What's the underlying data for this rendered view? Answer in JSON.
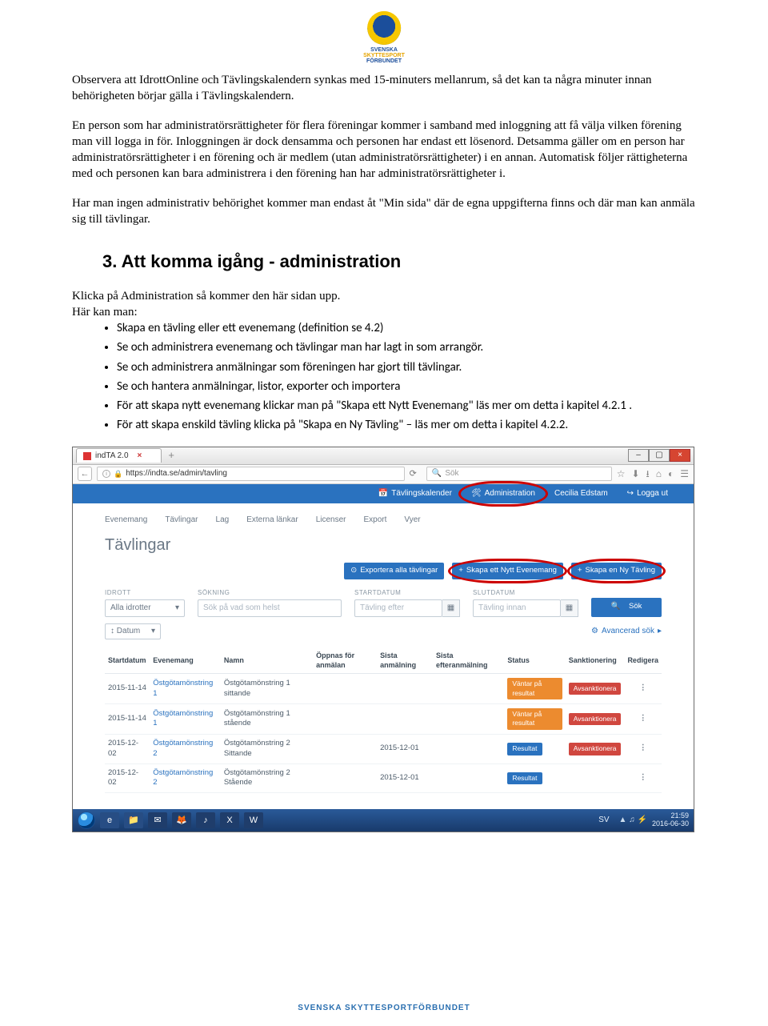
{
  "emblem": {
    "line1": "SVENSKA",
    "line2": "SKYTTESPORT",
    "line3": "FÖRBUNDET"
  },
  "body": {
    "p1": "Observera att IdrottOnline och Tävlingskalendern synkas med 15-minuters mellanrum, så det kan ta några minuter innan behörigheten börjar gälla i Tävlingskalendern.",
    "p2": "En person som har administratörsrättigheter för flera föreningar kommer i samband med inloggning att få välja vilken förening man vill logga in för. Inloggningen är dock densamma och personen har endast ett lösenord. Detsamma gäller om en person har administratörsrättigheter i en förening och är medlem (utan administratörsrättigheter) i en annan. Automatisk följer rättigheterna med och personen kan bara administrera i den förening han har administratörsrättigheter i.",
    "p3": "Har man ingen administrativ behörighet kommer man endast åt \"Min sida\" där de egna uppgifterna finns och där man kan anmäla sig till tävlingar.",
    "heading": "3. Att komma igång - administration",
    "p4": "Klicka på Administration så kommer den här sidan upp.",
    "p5": "Här kan man:",
    "bullets": [
      "Skapa en tävling eller ett evenemang (definition se 4.2)",
      "Se och administrera evenemang och tävlingar man har lagt in som arrangör.",
      "Se och administrera anmälningar som föreningen har gjort till tävlingar.",
      "Se och hantera anmälningar, listor, exporter och importera",
      "För att skapa nytt evenemang klickar man på \"Skapa ett Nytt Evenemang\" läs mer om detta i kapitel 4.2.1 .",
      "För att skapa enskild tävling klicka på \"Skapa en Ny Tävling\" – läs mer om detta i kapitel 4.2.2."
    ]
  },
  "shot": {
    "tab_title": "indTA 2.0",
    "url": "https://indta.se/admin/tavling",
    "search_placeholder": "Sök",
    "bluebar": {
      "calendar": "Tävlingskalender",
      "admin": "Administration",
      "user": "Cecilia Edstam",
      "logout": "Logga ut"
    },
    "nav2": [
      "Evenemang",
      "Tävlingar",
      "Lag",
      "Externa länkar",
      "Licenser",
      "Export",
      "Vyer"
    ],
    "page_title": "Tävlingar",
    "actions": {
      "export": "Exportera alla tävlingar",
      "new_event": "Skapa ett Nytt Evenemang",
      "new_comp": "Skapa en Ny Tävling"
    },
    "filters": {
      "idrott_label": "IDROTT",
      "idrott_value": "Alla idrotter",
      "sokning_label": "SÖKNING",
      "sokning_placeholder": "Sök på vad som helst",
      "start_label": "STARTDATUM",
      "start_placeholder": "Tävling efter",
      "slut_label": "SLUTDATUM",
      "slut_placeholder": "Tävling innan",
      "sok_btn": "Sök",
      "datum_select": "Datum",
      "advanced": "Avancerad sök"
    },
    "table": {
      "headers": [
        "Startdatum",
        "Evenemang",
        "Namn",
        "Öppnas för anmälan",
        "Sista anmälning",
        "Sista efteranmälning",
        "Status",
        "Sanktionering",
        "Redigera"
      ],
      "rows": [
        {
          "date": "2015-11-14",
          "event": "Östgötamönstring 1",
          "name": "Östgötamönstring 1 sittande",
          "open": "",
          "last": "",
          "late": "",
          "status": "Väntar på resultat",
          "status_cls": "orange",
          "sank": "Avsanktionera"
        },
        {
          "date": "2015-11-14",
          "event": "Östgötamönstring 1",
          "name": "Östgötamönstring 1 stående",
          "open": "",
          "last": "",
          "late": "",
          "status": "Väntar på resultat",
          "status_cls": "orange",
          "sank": "Avsanktionera"
        },
        {
          "date": "2015-12-02",
          "event": "Östgötamönstring 2",
          "name": "Östgötamönstring 2 Sittande",
          "open": "",
          "last": "2015-12-01",
          "late": "",
          "status": "Resultat",
          "status_cls": "blue",
          "sank": "Avsanktionera"
        },
        {
          "date": "2015-12-02",
          "event": "Östgötamönstring 2",
          "name": "Östgötamönstring 2 Stående",
          "open": "",
          "last": "2015-12-01",
          "late": "",
          "status": "Resultat",
          "status_cls": "blue",
          "sank": ""
        }
      ]
    },
    "taskbar": {
      "lang": "SV",
      "time": "21:59",
      "date": "2016-06-30"
    }
  },
  "footer": "SVENSKA SKYTTESPORTFÖRBUNDET"
}
